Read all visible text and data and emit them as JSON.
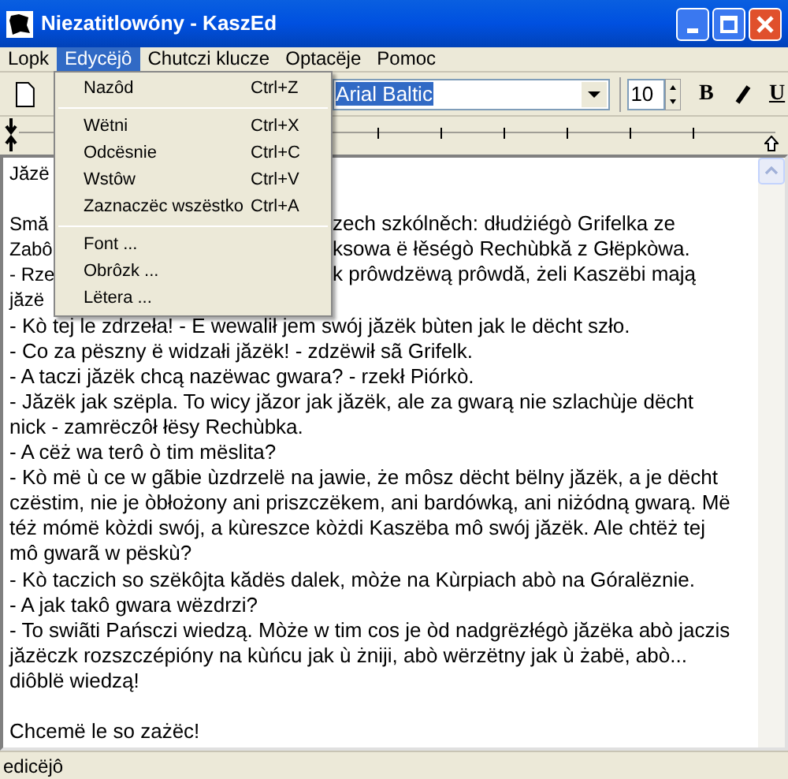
{
  "window": {
    "title": "Niezatitlowóny - KaszEd"
  },
  "menubar": [
    {
      "label": "Lopk",
      "selected": false
    },
    {
      "label": "Edycëjô",
      "selected": true
    },
    {
      "label": "Chutczi klucze",
      "selected": false
    },
    {
      "label": "Optacëje",
      "selected": false
    },
    {
      "label": "Pomoc",
      "selected": false
    }
  ],
  "edit_menu": {
    "items": [
      {
        "kind": "item",
        "label": "Nazôd",
        "shortcut": "Ctrl+Z"
      },
      {
        "kind": "separator"
      },
      {
        "kind": "item",
        "label": "Wëtni",
        "shortcut": "Ctrl+X"
      },
      {
        "kind": "item",
        "label": "Odcësnie",
        "shortcut": "Ctrl+C"
      },
      {
        "kind": "item",
        "label": "Wstôw",
        "shortcut": "Ctrl+V"
      },
      {
        "kind": "item",
        "label": "Zaznaczëc wszëstko",
        "shortcut": "Ctrl+A"
      },
      {
        "kind": "separator"
      },
      {
        "kind": "item",
        "label": "Font ..."
      },
      {
        "kind": "item",
        "label": "Obrôzk ..."
      },
      {
        "kind": "item",
        "label": "Lëtera ..."
      }
    ]
  },
  "toolbar": {
    "font": "Arial Baltic",
    "size": "10",
    "format_buttons": [
      "B",
      "U"
    ]
  },
  "editor": {
    "lines": [
      {
        "kind": "split",
        "left": "Jăzë"
      },
      {
        "kind": "blank"
      },
      {
        "kind": "split",
        "left": "Smă",
        "right": "zech szkólněch: dłudżiégò Grifelka ze"
      },
      {
        "kind": "split",
        "left": "Zabô",
        "right": "ksowa ë łěségò Rechùbkă z Głëpkòwa."
      },
      {
        "kind": "split",
        "left": "- Rze",
        "right": "k prôwdzëwą prôwdă, żeli Kaszëbi mają"
      },
      {
        "kind": "split",
        "left": "jăzë"
      },
      {
        "kind": "text",
        "text": "- Kò tej le zdrzeła! - E wewalił jem swój jăzëk bùten jak le dëcht szło."
      },
      {
        "kind": "text",
        "text": "- Co za pëszny ë widzałi jăzëk! - zdzëwił sã Grifelk."
      },
      {
        "kind": "text",
        "text": "- A taczi jăzëk chcą nazëwac gwara? - rzekł Piórkò."
      },
      {
        "kind": "text",
        "text": "- Jăzëk jak szëpla. To wicy jăzor jak jăzëk, ale za gwarą nie szlachùje dëcht"
      },
      {
        "kind": "text",
        "text": "nick - zamrëczôł łësy Rechùbka."
      },
      {
        "kind": "text",
        "text": "- A cëż wa terô ò tim mëslita?"
      },
      {
        "kind": "text",
        "text": "- Kò më ù ce w gãbie ùzdrzelë na jawie, że môsz dëcht bëlny jăzëk, a je dëcht"
      },
      {
        "kind": "text",
        "text": "czëstim, nie je òbłożony ani priszczëkem, ani bardówką, ani niżódną gwarą. Më"
      },
      {
        "kind": "text",
        "text": "téż mómë kòżdi swój, a kùreszce kòżdi Kaszëba mô swój jăzëk. Ale chtëż tej"
      },
      {
        "kind": "text",
        "text": "mô gwarã w pëskù?"
      },
      {
        "kind": "text",
        "text": "- Kò taczich so szëkôjta kădës dalek, mòże na Kùrpiach abò na Góralëznie."
      },
      {
        "kind": "text",
        "text": "- A jak takô gwara wëzdrzi?"
      },
      {
        "kind": "text",
        "text": "- To swiãti Pańsczi wiedzą. Mòże w tim cos je òd nadgrëzłégò jăzëka abò jaczis"
      },
      {
        "kind": "text",
        "text": "jăzëczk rozszczépióny na kùńcu jak ù żniji, abò wërzëtny jak ù żabë, abò..."
      },
      {
        "kind": "text",
        "text": "diôblë wiedzą!"
      },
      {
        "kind": "blank"
      },
      {
        "kind": "text",
        "text": "Chcemë le so zażëc!"
      }
    ]
  },
  "status_bar": "edicëjô"
}
